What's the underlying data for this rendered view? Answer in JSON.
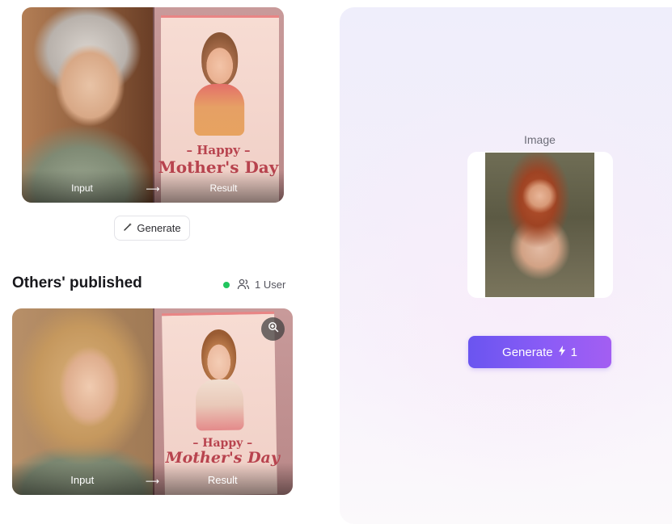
{
  "example": {
    "input_caption": "Input",
    "result_caption": "Result",
    "arrow": "⟶",
    "card_line1": "– Happy –",
    "card_line2": "Mother's Day"
  },
  "generate_small": {
    "label": "Generate",
    "icon": "magic-wand-icon"
  },
  "others": {
    "title": "Others' published",
    "online_status_color": "#22c55e",
    "user_count": "1 User",
    "item": {
      "input_caption": "Input",
      "result_caption": "Result",
      "arrow": "⟶",
      "card_line1": "– Happy –",
      "card_line2": "Mother's Day",
      "zoom_icon": "zoom-in-icon"
    }
  },
  "panel": {
    "image_label": "Image",
    "generate_label": "Generate",
    "credit_icon": "lightning-icon",
    "credit_cost": "1",
    "accent": "#7c5cf5"
  }
}
